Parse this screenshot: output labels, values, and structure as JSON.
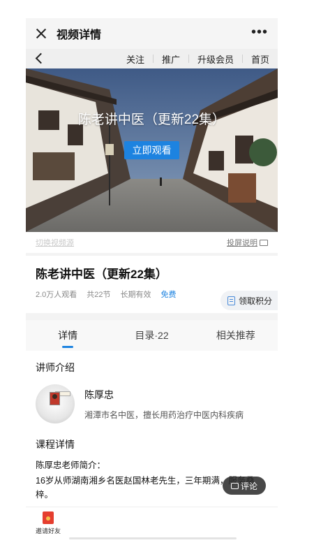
{
  "titlebar": {
    "title": "视频详情",
    "more": "•••"
  },
  "navbar": {
    "links": [
      "关注",
      "推广",
      "升级会员",
      "首页"
    ]
  },
  "video": {
    "title": "陈老讲中医（更新22集）",
    "watch_label": "立即观看"
  },
  "subbar": {
    "switch_label": "切换视频源",
    "cast_label": "投屏说明"
  },
  "course": {
    "title": "陈老讲中医（更新22集）",
    "views": "2.0万人观看",
    "sections": "共22节",
    "validity": "长期有效",
    "price": "免费",
    "points_label": "领取积分"
  },
  "tabs": [
    "详情",
    "目录·22",
    "相关推荐"
  ],
  "lecturer": {
    "section_title": "讲师介绍",
    "name": "陈厚忠",
    "desc": "湘潭市名中医，擅长用药治疗中医内科疾病"
  },
  "detail": {
    "section_title": "课程详情",
    "intro": "陈厚忠老师简介：",
    "body": "16岁从师湖南湘乡名医赵国林老先生，三年期满，服务桑梓。"
  },
  "comment_label": "评论",
  "invite_label": "邀请好友",
  "colors": {
    "accent": "#1d83e0",
    "invite_red": "#e53e2f"
  }
}
